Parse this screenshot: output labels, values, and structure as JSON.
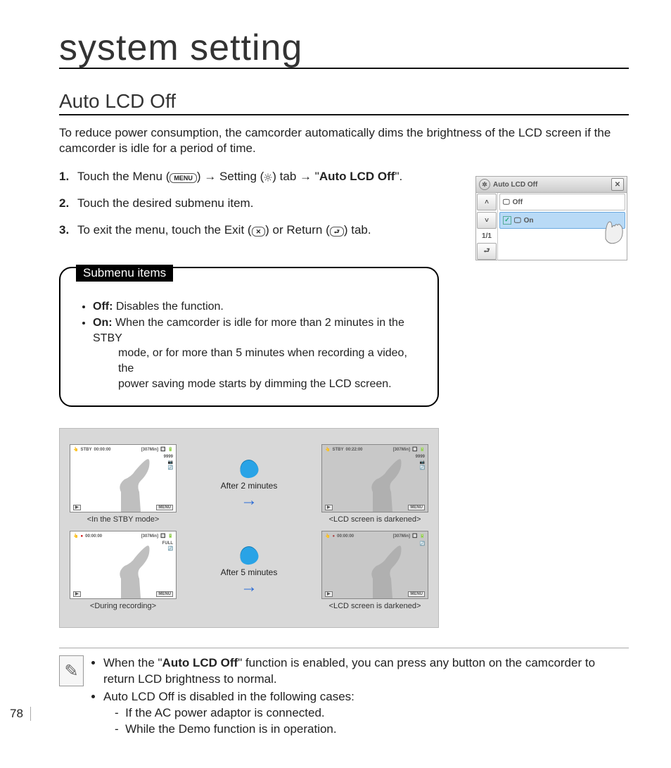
{
  "chapter_title": "system setting",
  "section_title": "Auto LCD Off",
  "intro": "To reduce power consumption, the camcorder automatically dims the brightness of the LCD screen if the camcorder is idle for a period of time.",
  "steps": {
    "s1_a": "Touch the Menu (",
    "s1_menu": "MENU",
    "s1_b": ") ",
    "s1_arrow1": "→",
    "s1_c": " Setting (",
    "s1_d": ") tab ",
    "s1_arrow2": "→",
    "s1_e": " \"",
    "s1_bold": "Auto LCD Off",
    "s1_f": "\".",
    "s2": "Touch the desired submenu item.",
    "s3_a": "To exit the menu, touch the Exit (",
    "s3_b": ") or Return (",
    "s3_c": ") tab."
  },
  "submenu": {
    "tag": "Submenu items",
    "off_label": "Off:",
    "off_text": " Disables the function.",
    "on_label": "On:",
    "on_text_a": " When the camcorder is idle for more than 2 minutes in the STBY",
    "on_text_b": "mode, or for more than 5 minutes when recording a video, the",
    "on_text_c": "power saving mode starts by dimming the LCD screen."
  },
  "lcdmenu": {
    "title": "Auto LCD Off",
    "item_off": "Off",
    "item_on": "On",
    "page": "1/1"
  },
  "screens": {
    "after2": "After 2 minutes",
    "after5": "After 5 minutes",
    "cap_stby": "<In the STBY mode>",
    "cap_dark": "<LCD screen is darkened>",
    "cap_rec": "<During recording>",
    "stby": "STBY",
    "time": "00:00:00",
    "time2": "00:22:00",
    "remain": "[307Min]",
    "count": "9999",
    "menu": "MENU"
  },
  "note": {
    "a1": "When the \"",
    "a_bold": "Auto LCD Off",
    "a2": "\" function is enabled, you can press any button on the camcorder to return LCD brightness to normal.",
    "b": "Auto LCD Off is disabled in the following cases:",
    "b1": "If the AC power adaptor is connected.",
    "b2": "While the Demo function is in operation."
  },
  "pageno": "78"
}
